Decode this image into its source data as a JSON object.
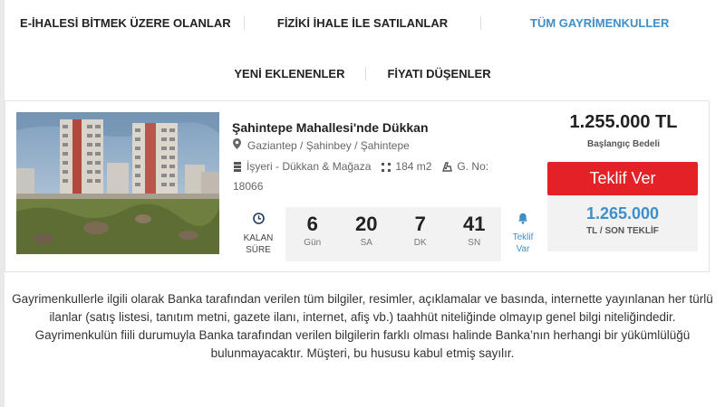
{
  "tabs_row1": [
    {
      "label": "E-İHALESİ BİTMEK ÜZERE OLANLAR",
      "active": false
    },
    {
      "label": "FİZİKİ İHALE İLE SATILANLAR",
      "active": false
    },
    {
      "label": "TÜM GAYRİMENKULLER",
      "active": true
    }
  ],
  "tabs_row2": [
    {
      "label": "YENİ EKLENENLER"
    },
    {
      "label": "FİYATI DÜŞENLER"
    }
  ],
  "listing": {
    "title": "Şahintepe Mahallesi'nde Dükkan",
    "location": "Gaziantep / Şahinbey / Şahintepe",
    "category": "İşyeri - Dükkan & Mağaza",
    "area": "184 m2",
    "gno_label": "G. No:",
    "gno_value": "18066",
    "timer_label_1": "KALAN",
    "timer_label_2": "SÜRE",
    "countdown": [
      {
        "value": "6",
        "unit": "Gün"
      },
      {
        "value": "20",
        "unit": "SA"
      },
      {
        "value": "7",
        "unit": "DK"
      },
      {
        "value": "41",
        "unit": "SN"
      }
    ],
    "bid_link_1": "Teklif",
    "bid_link_2": "Var",
    "price": "1.255.000 TL",
    "price_label": "Başlangıç Bedeli",
    "offer_button": "Teklif Ver",
    "last_bid": "1.265.000",
    "last_bid_label": "TL / SON TEKLİF"
  },
  "disclaimer": "Gayrimenkullerle ilgili olarak Banka tarafından verilen tüm bilgiler, resimler, açıklamalar ve basında, internette yayınlanan her türlü ilanlar (satış listesi, tanıtım metni, gazete ilanı, internet, afiş vb.) taahhüt niteliğinde olmayıp genel bilgi niteliğindedir. Gayrimenkulün fiili durumuyla Banka tarafından verilen bilgilerin farklı olması halinde Banka’nın herhangi bir yükümlülüğü bulunmayacaktır. Müşteri, bu hususu kabul etmiş sayılır.",
  "colors": {
    "accent": "#3d8fc9",
    "cta": "#e32127",
    "panel": "#f2f2f2"
  },
  "icons": [
    "map-pin-icon",
    "building-icon",
    "area-icon",
    "land-icon",
    "clock-icon",
    "bell-icon"
  ]
}
